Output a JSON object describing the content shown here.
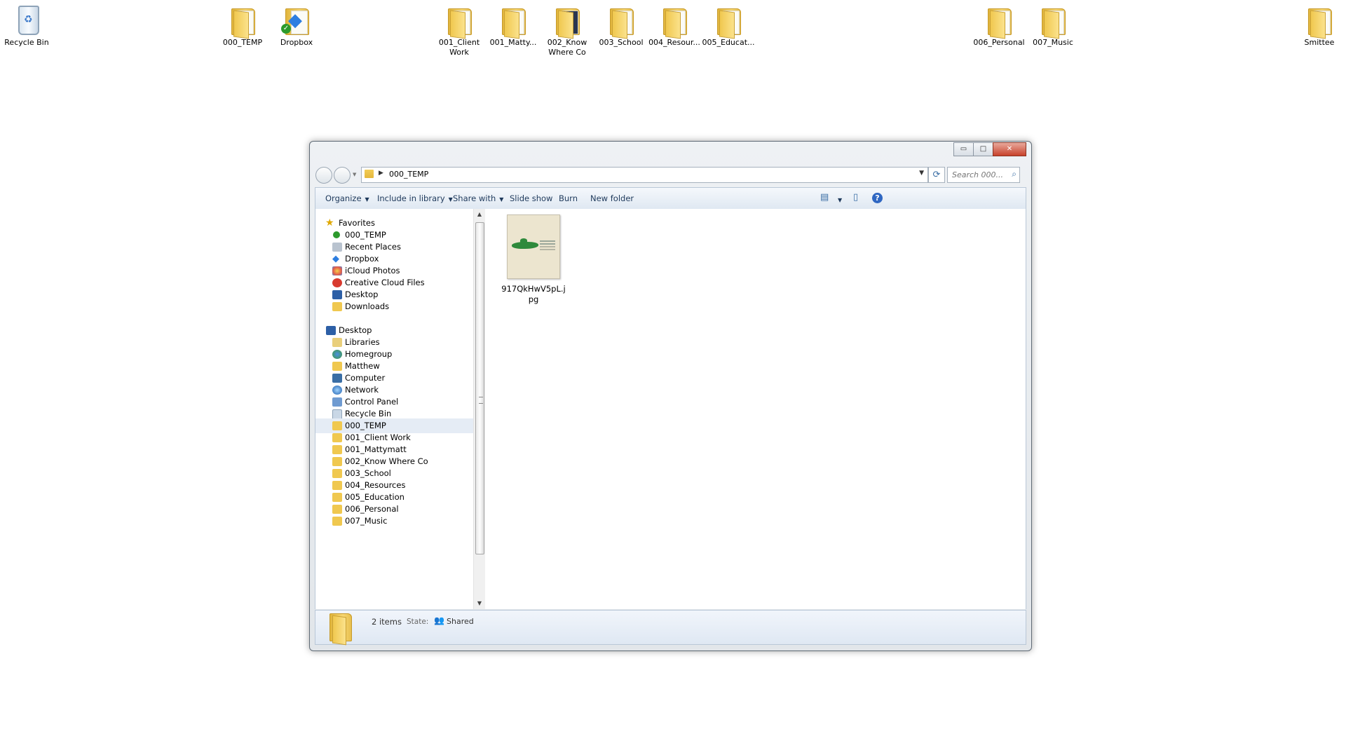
{
  "desktop": {
    "icons": [
      {
        "label": "Recycle Bin",
        "kind": "recycle-bin"
      },
      {
        "label": "000_TEMP",
        "kind": "folder"
      },
      {
        "label": "Dropbox",
        "kind": "dropbox"
      },
      {
        "label": "001_Client Work",
        "kind": "folder"
      },
      {
        "label": "001_Matty...",
        "kind": "folder"
      },
      {
        "label": "002_Know Where Co",
        "kind": "folder"
      },
      {
        "label": "003_School",
        "kind": "folder"
      },
      {
        "label": "004_Resour...",
        "kind": "folder"
      },
      {
        "label": "005_Educat...",
        "kind": "folder"
      },
      {
        "label": "006_Personal",
        "kind": "folder"
      },
      {
        "label": "007_Music",
        "kind": "folder"
      },
      {
        "label": "Smittee",
        "kind": "folder"
      }
    ]
  },
  "window": {
    "caption": {
      "minimize": "▭",
      "maximize": "□",
      "close": "✕"
    },
    "address": {
      "path": "000_TEMP"
    },
    "search": {
      "placeholder": "Search 000..."
    },
    "toolbar": {
      "organize": "Organize",
      "include_in_library": "Include in library",
      "share_with": "Share with",
      "slide_show": "Slide show",
      "burn": "Burn",
      "new_folder": "New folder",
      "help": "?"
    },
    "nav": {
      "favorites_header": "Favorites",
      "favorites": [
        "000_TEMP",
        "Recent Places",
        "Dropbox",
        "iCloud Photos",
        "Creative Cloud Files",
        "Desktop",
        "Downloads"
      ],
      "desktop_header": "Desktop",
      "desktop_items": [
        "Libraries",
        "Homegroup",
        "Matthew",
        "Computer",
        "Network",
        "Control Panel",
        "Recycle Bin",
        "000_TEMP",
        "001_Client Work",
        "001_Mattymatt",
        "002_Know Where Co",
        "003_School",
        "004_Resources",
        "005_Education",
        "006_Personal",
        "007_Music"
      ],
      "selected": "000_TEMP"
    },
    "files": [
      {
        "name": "917QkHwV5pL.jpg"
      }
    ],
    "status": {
      "count": "2 items",
      "state_label": "State:",
      "state_value": "Shared"
    }
  },
  "colors": {
    "folder": "#f0c84f",
    "toolbar_text": "#1e395b",
    "selection": "#e5ecf5",
    "close_button": "#c7412b"
  }
}
